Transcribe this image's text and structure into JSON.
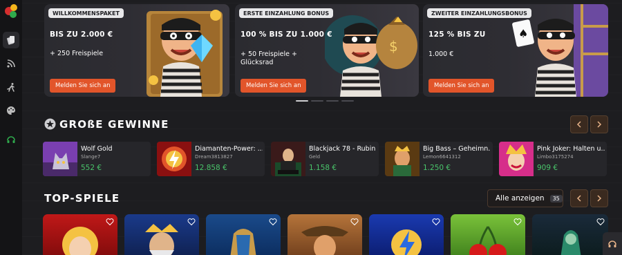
{
  "promos": [
    {
      "tag": "WILLKOMMENSPAKET",
      "headline": "BIS ZU 2.000 €",
      "sub": "+ 250 Freispiele",
      "cta": "Melden Sie sich an"
    },
    {
      "tag": "ERSTE EINZAHLUNG BONUS",
      "headline": "100 % BIS ZU 1.000 €",
      "sub": "+ 50 Freispiele + Glücksrad",
      "cta": "Melden Sie sich an"
    },
    {
      "tag": "ZWEITER EINZAHLUNGSBONUS",
      "headline": "125 % BIS ZU",
      "sub": "1.000 €",
      "cta": "Melden Sie sich an"
    }
  ],
  "carousel": {
    "slides": 4,
    "active": 0
  },
  "big_wins": {
    "title": "GROßE GEWINNE",
    "items": [
      {
        "game": "Wolf Gold",
        "user": "Slange7",
        "amount": "552 €"
      },
      {
        "game": "Diamanten-Power: ...",
        "user": "Dream3813827",
        "amount": "12.858 €"
      },
      {
        "game": "Blackjack 78 - Rubin",
        "user": "Geld",
        "amount": "1.158 €"
      },
      {
        "game": "Big Bass – Geheimn...",
        "user": "Lemon6641312",
        "amount": "1.250 €"
      },
      {
        "game": "Pink Joker: Halten u...",
        "user": "Limbo3175274",
        "amount": "909 €"
      }
    ]
  },
  "top_games": {
    "title": "TOP-SPIELE",
    "show_all_label": "Alle anzeigen",
    "show_all_count": "35"
  },
  "sidebar": {
    "icons": [
      "logo-icon",
      "cards-icon",
      "rss-icon",
      "runner-icon",
      "palette-icon",
      "headset-icon"
    ]
  },
  "colors": {
    "accent": "#e2552a",
    "win_green": "#49c46a",
    "background": "#1b1b1d"
  }
}
